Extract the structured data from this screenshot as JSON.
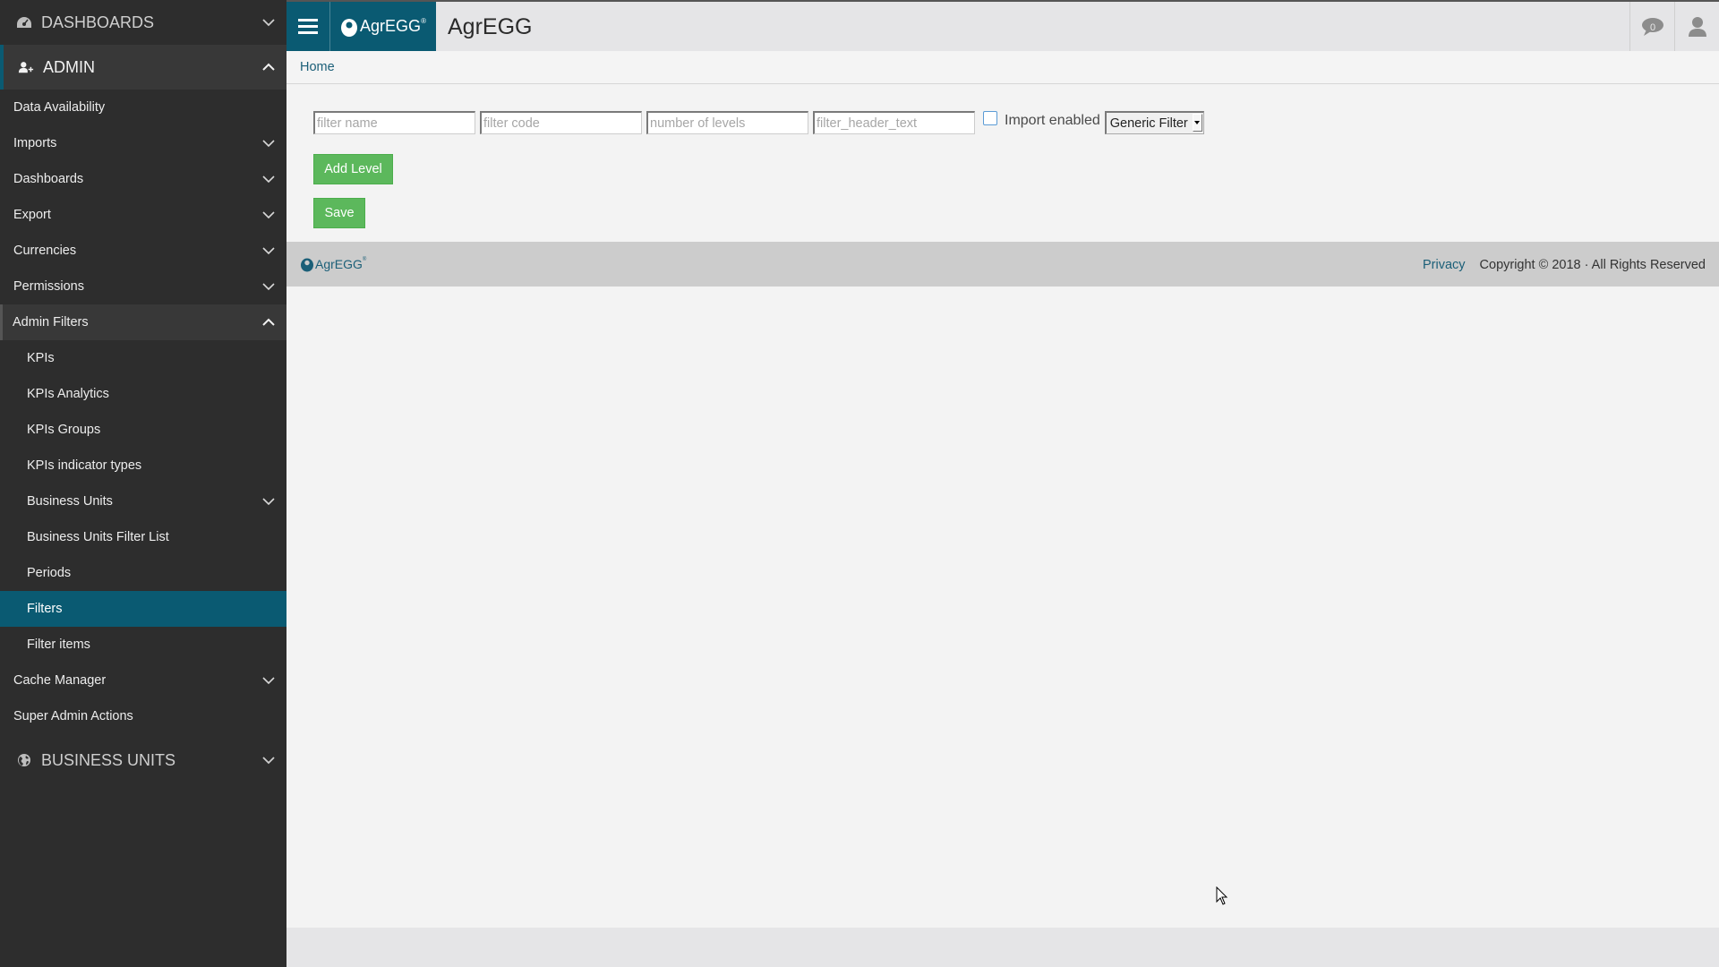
{
  "sidebar": {
    "sections": {
      "dashboards": {
        "label": "DASHBOARDS",
        "icon": "dashboard-icon"
      },
      "admin": {
        "label": "ADMIN",
        "icon": "user-plus-icon"
      },
      "business_units": {
        "label": "BUSINESS UNITS",
        "icon": "globe-icon"
      }
    },
    "admin_items": [
      {
        "label": "Data Availability",
        "has_chevron": false
      },
      {
        "label": "Imports",
        "has_chevron": true
      },
      {
        "label": "Dashboards",
        "has_chevron": true
      },
      {
        "label": "Export",
        "has_chevron": true
      },
      {
        "label": "Currencies",
        "has_chevron": true
      },
      {
        "label": "Permissions",
        "has_chevron": true
      },
      {
        "label": "Admin Filters",
        "expanded": true
      }
    ],
    "admin_filters_items": [
      {
        "label": "KPIs"
      },
      {
        "label": "KPIs Analytics"
      },
      {
        "label": "KPIs Groups"
      },
      {
        "label": "KPIs indicator types"
      },
      {
        "label": "Business Units",
        "has_chevron": true
      },
      {
        "label": "Business Units Filter List"
      },
      {
        "label": "Periods"
      },
      {
        "label": "Filters",
        "active": true
      },
      {
        "label": "Filter items"
      }
    ],
    "trailing_items": [
      {
        "label": "Cache Manager",
        "has_chevron": true
      },
      {
        "label": "Super Admin Actions"
      }
    ]
  },
  "header": {
    "brand": "AgrEGG",
    "brand_reg": "®",
    "title": "AgrEGG",
    "chat_count": "0"
  },
  "breadcrumb": {
    "home": "Home"
  },
  "form": {
    "filter_name": {
      "value": "",
      "placeholder": "filter name"
    },
    "filter_code": {
      "value": "",
      "placeholder": "filter code"
    },
    "number_of_levels": {
      "value": "",
      "placeholder": "number of levels"
    },
    "filter_header_text": {
      "value": "",
      "placeholder": "filter_header_text"
    },
    "import_enabled": {
      "label": "Import enabled",
      "checked": false
    },
    "filter_type": {
      "selected": "Generic Filter"
    },
    "add_level_label": "Add Level",
    "save_label": "Save"
  },
  "footer": {
    "logo": "AgrEGG",
    "logo_reg": "®",
    "privacy": "Privacy",
    "copyright": "Copyright © 2018 · All Rights Reserved"
  },
  "colors": {
    "brand": "#0a5a72",
    "sidebar_bg": "#2d2d2d",
    "button_green": "#5cb85c",
    "link": "#1b5f78"
  }
}
